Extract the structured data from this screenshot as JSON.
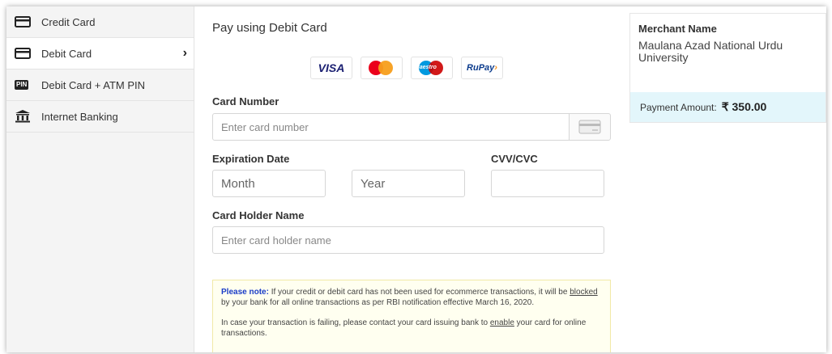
{
  "sidebar": {
    "items": [
      {
        "label": "Credit Card",
        "icon": "credit-card-icon"
      },
      {
        "label": "Debit Card",
        "icon": "debit-card-icon",
        "active": true,
        "chevron": "›"
      },
      {
        "label": "Debit Card + ATM PIN",
        "icon": "pin-icon",
        "badge": "PIN"
      },
      {
        "label": "Internet Banking",
        "icon": "bank-icon"
      }
    ]
  },
  "main": {
    "title": "Pay using Debit Card",
    "logos": {
      "visa": "VISA",
      "maestro": "Maestro",
      "rupay": "RuPay",
      "rupay_tail": "›"
    },
    "card_number": {
      "label": "Card Number",
      "placeholder": "Enter card number"
    },
    "expiration": {
      "label": "Expiration Date",
      "month_placeholder": "Month",
      "year_placeholder": "Year"
    },
    "cvv": {
      "label": "CVV/CVC",
      "placeholder": ""
    },
    "holder": {
      "label": "Card Holder Name",
      "placeholder": "Enter card holder name"
    },
    "note": {
      "heading": "Please note:",
      "p1_a": " If your credit or debit card has not been used for ecommerce transactions, it will be ",
      "p1_link": "blocked",
      "p1_b": " by your bank for all online transactions as per RBI notification effective March 16, 2020.",
      "p2_a": "In case your transaction is failing, please contact your card issuing bank to ",
      "p2_link": "enable",
      "p2_b": " your card for online transactions."
    }
  },
  "merchant": {
    "name_label": "Merchant Name",
    "name": "Maulana Azad National Urdu University",
    "amount_label": "Payment Amount:",
    "amount": "₹ 350.00"
  },
  "colors": {
    "accent_bar": "#e3f6fb",
    "note_heading": "#1a3cc7",
    "note_bg": "#fffff0"
  }
}
